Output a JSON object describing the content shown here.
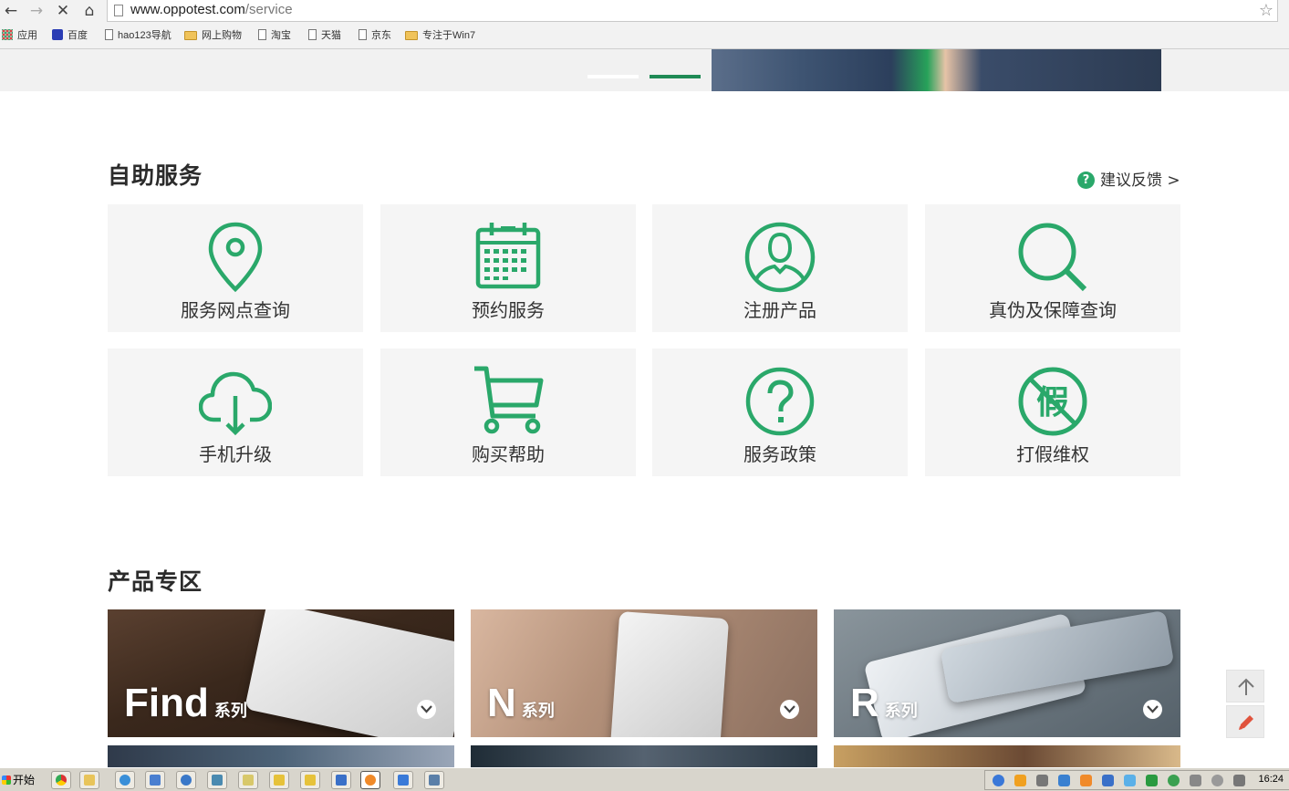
{
  "browser": {
    "url_host": "www.oppotest.com",
    "url_path": "/service",
    "bookmarks": [
      {
        "label": "应用",
        "icon": "apps-icon"
      },
      {
        "label": "百度",
        "icon": "baidu-icon"
      },
      {
        "label": "hao123导航",
        "icon": "page-icon"
      },
      {
        "label": "网上购物",
        "icon": "folder-icon"
      },
      {
        "label": "淘宝",
        "icon": "page-icon"
      },
      {
        "label": "天猫",
        "icon": "page-icon"
      },
      {
        "label": "京东",
        "icon": "page-icon"
      },
      {
        "label": "专注于Win7",
        "icon": "folder-icon"
      }
    ]
  },
  "colors": {
    "accent": "#2aa86a",
    "tile_bg": "#f5f5f5",
    "title": "#2b2b2b"
  },
  "self_service": {
    "title": "自助服务",
    "feedback_label": "建议反馈 >",
    "items": [
      {
        "label": "服务网点查询",
        "icon": "location-pin-icon"
      },
      {
        "label": "预约服务",
        "icon": "calendar-icon"
      },
      {
        "label": "注册产品",
        "icon": "user-icon"
      },
      {
        "label": "真伪及保障查询",
        "icon": "search-icon"
      },
      {
        "label": "手机升级",
        "icon": "cloud-download-icon"
      },
      {
        "label": "购买帮助",
        "icon": "cart-icon"
      },
      {
        "label": "服务政策",
        "icon": "question-icon"
      },
      {
        "label": "打假维权",
        "icon": "no-fake-icon"
      }
    ]
  },
  "products": {
    "title": "产品专区",
    "series": [
      {
        "name": "Find",
        "suffix": "系列"
      },
      {
        "name": "N",
        "suffix": "系列"
      },
      {
        "name": "R",
        "suffix": "系列"
      }
    ]
  },
  "taskbar": {
    "start_label": "开始",
    "clock": "16:24"
  }
}
